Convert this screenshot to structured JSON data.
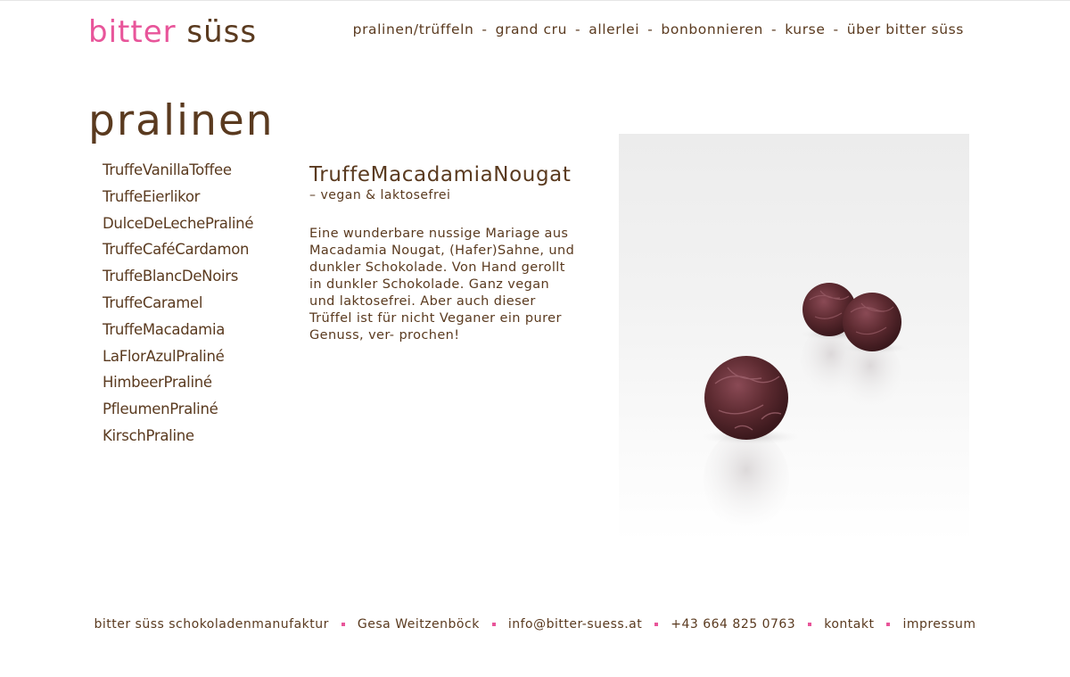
{
  "brand": {
    "word1": "bitter",
    "word2": "süss",
    "color_pink": "#e8559a",
    "color_brown": "#5a3a1f"
  },
  "nav": {
    "items": [
      "pralinen/trüffeln",
      "grand cru",
      "allerlei",
      "bonbonnieren",
      "kurse",
      "über bitter süss"
    ],
    "separator": "-"
  },
  "section": {
    "title": "pralinen"
  },
  "products": [
    "TruffeVanillaToffee",
    "TruffeEierlikor",
    "DulceDeLechePraliné",
    "TruffeCaféCardamon",
    "TruffeBlancDeNoirs",
    "TruffeCaramel",
    "TruffeMacadamia",
    "LaFlorAzulPraliné",
    "HimbeerPraliné",
    "PfleumenPraliné",
    "KirschPraline"
  ],
  "detail": {
    "title": "TruffeMacadamiaNougat",
    "subtitle": "– vegan & laktosefrei",
    "description": "Eine wunderbare nussige Mariage aus Macadamia Nougat, (Hafer)Sahne, und dunkler Schokolade. Von Hand gerollt in dunkler Schokolade. Ganz vegan und laktosefrei. Aber auch dieser Trüffel ist für nicht Veganer ein purer Genuss, ver- prochen!"
  },
  "footer": {
    "company": "bitter süss schokoladenmanufaktur",
    "person": "Gesa Weitzenböck",
    "email": "info@bitter-suess.at",
    "phone": "+43 664 825 0763",
    "contact": "kontakt",
    "imprint": "impressum"
  }
}
